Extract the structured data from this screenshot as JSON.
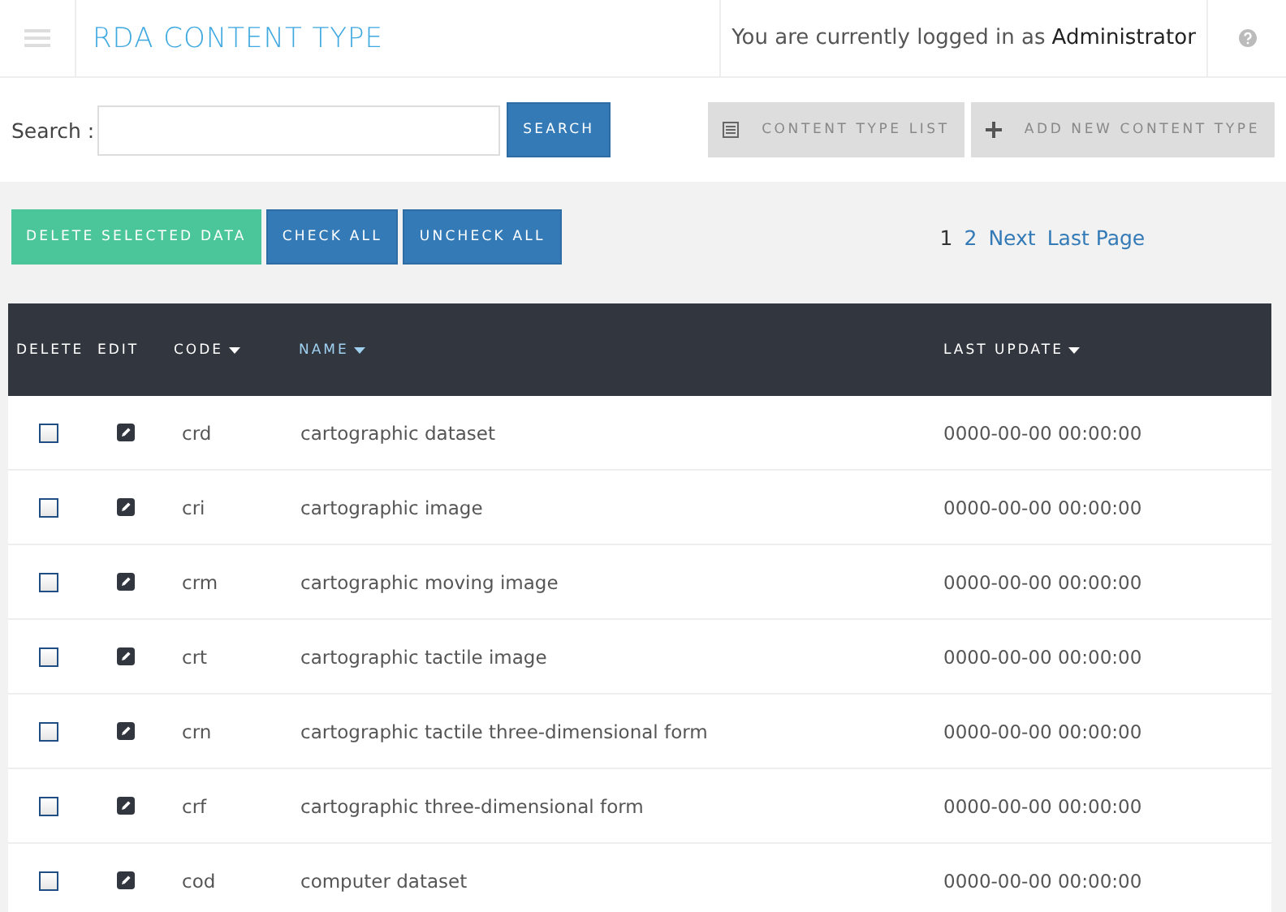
{
  "header": {
    "title": "RDA CONTENT TYPE",
    "login_text": "You are currently logged in as",
    "user": "Administrator"
  },
  "search": {
    "label": "Search :",
    "button": "SEARCH"
  },
  "toolbar": [
    {
      "label": "CONTENT TYPE LIST",
      "kind": "list"
    },
    {
      "label": "ADD NEW CONTENT TYPE",
      "kind": "add"
    }
  ],
  "actions": [
    {
      "label": "DELETE SELECTED DATA",
      "kind": "danger"
    },
    {
      "label": "CHECK ALL",
      "kind": "primary"
    },
    {
      "label": "UNCHECK ALL",
      "kind": "primary"
    }
  ],
  "pagination": [
    {
      "label": "1",
      "selected": true
    },
    {
      "label": "2",
      "selected": false
    },
    {
      "label": "Next",
      "selected": false
    },
    {
      "label": "Last Page",
      "selected": false
    }
  ],
  "table": {
    "columns": [
      {
        "label": "DELETE",
        "sortable": false,
        "selected": false
      },
      {
        "label": "EDIT",
        "sortable": false,
        "selected": false
      },
      {
        "label": "CODE",
        "sortable": true,
        "selected": false
      },
      {
        "label": "NAME",
        "sortable": true,
        "selected": true
      },
      {
        "label": "LAST UPDATE",
        "sortable": true,
        "selected": false
      }
    ],
    "rows": [
      {
        "checked": false,
        "code": "crd",
        "name": "cartographic dataset",
        "last_update": "0000-00-00 00:00:00"
      },
      {
        "checked": false,
        "code": "cri",
        "name": "cartographic image",
        "last_update": "0000-00-00 00:00:00"
      },
      {
        "checked": false,
        "code": "crm",
        "name": "cartographic moving image",
        "last_update": "0000-00-00 00:00:00"
      },
      {
        "checked": false,
        "code": "crt",
        "name": "cartographic tactile image",
        "last_update": "0000-00-00 00:00:00"
      },
      {
        "checked": false,
        "code": "crn",
        "name": "cartographic tactile three-dimensional form",
        "last_update": "0000-00-00 00:00:00"
      },
      {
        "checked": false,
        "code": "crf",
        "name": "cartographic three-dimensional form",
        "last_update": "0000-00-00 00:00:00"
      },
      {
        "checked": false,
        "code": "cod",
        "name": "computer dataset",
        "last_update": "0000-00-00 00:00:00"
      }
    ]
  }
}
